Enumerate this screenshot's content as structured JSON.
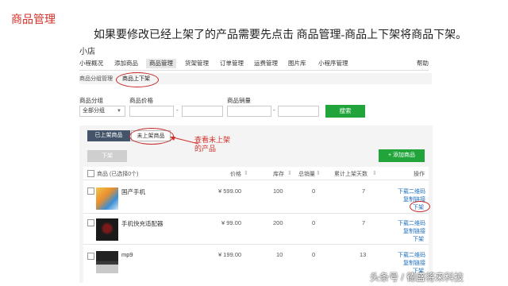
{
  "doc": {
    "heading": "商品管理",
    "instruction": "如果要修改已经上架了的产品需要先点击 商品管理-商品上下架将商品下架。",
    "annotation_line1": "查看未上架",
    "annotation_line2": "的产品",
    "watermark": "头条号 / 德盛将来科技"
  },
  "app": {
    "shop_name": "小店",
    "nav": [
      "小程概况",
      "添加商品",
      "商品管理",
      "货架管理",
      "订单管理",
      "运费管理",
      "图片库",
      "小程序管理"
    ],
    "help": "帮助",
    "subnav": [
      "商品分组管理",
      "商品上下架"
    ]
  },
  "filters": {
    "group_label": "商品分组",
    "group_value": "全部分组",
    "price_label": "商品价格",
    "sales_label": "商品销量",
    "range_sep": "-",
    "search_label": "搜索"
  },
  "toolbar": {
    "tab_on": "已上架商品",
    "tab_off": "未上架商品",
    "down_label": "下架",
    "add_label": "+ 添加商品"
  },
  "table": {
    "headers": {
      "product": "商品 (已选择0个)",
      "price": "价格",
      "stock": "库存",
      "sales": "总销量",
      "days": "累计上架天数",
      "actions": "操作"
    },
    "rows": [
      {
        "name": "国产手机",
        "price": "¥ 599.00",
        "stock": "100",
        "sales": "0",
        "days": "7"
      },
      {
        "name": "手机快充适配器",
        "price": "¥ 99.00",
        "stock": "200",
        "sales": "0",
        "days": "7"
      },
      {
        "name": "mp9",
        "price": "¥ 199.00",
        "stock": "10",
        "sales": "0",
        "days": "13"
      }
    ],
    "op_qrcode": "下载二维码",
    "op_copy": "复制链接",
    "op_down": "下架",
    "sort_icon": "sort-arrows-icon"
  },
  "colors": {
    "accent_green": "#21a53b",
    "annotation_red": "#d3302a",
    "link_blue": "#1f6fbf",
    "tab_dark": "#44546a"
  }
}
